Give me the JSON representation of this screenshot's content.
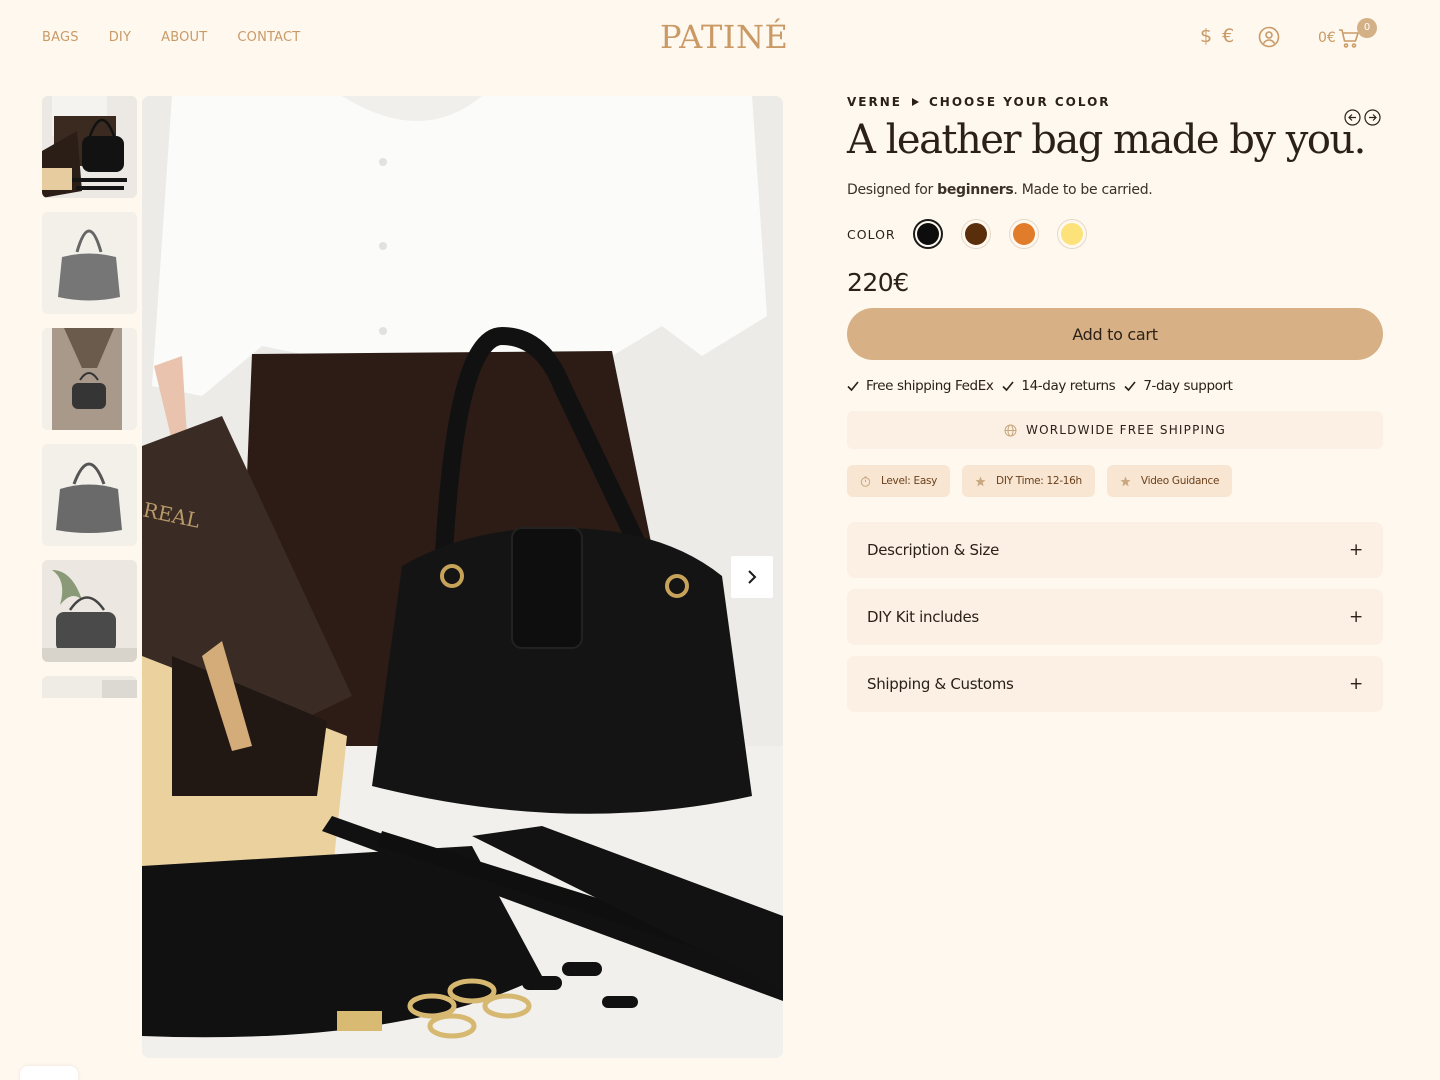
{
  "header": {
    "nav": [
      "BAGS",
      "DIY",
      "ABOUT",
      "CONTACT"
    ],
    "logo": "PATINÉ",
    "currency": "$ €",
    "cart_total": "0€",
    "cart_count": "0"
  },
  "gallery": {
    "thumbnails": [
      "kit-with-bag",
      "bag-front",
      "bag-held",
      "bag-front-2",
      "bag-plant",
      "partial"
    ],
    "next_icon": "chevron-right-icon"
  },
  "product": {
    "breadcrumb": [
      "VERNE",
      "CHOOSE YOUR COLOR"
    ],
    "title": "A leather bag made by you.",
    "subtitle_prefix": "Designed for ",
    "subtitle_bold": "beginners",
    "subtitle_suffix": ". Made to be carried.",
    "color_label": "COLOR",
    "colors": [
      "#0d0d0d",
      "#5a2e0b",
      "#e07c2a",
      "#fde27a"
    ],
    "selected_color": "#0d0d0d",
    "price": "220€",
    "add_to_cart": "Add to cart",
    "perks": [
      "Free shipping FedEx",
      "14-day returns",
      "7-day support"
    ],
    "shipping_banner": "WORLDWIDE FREE SHIPPING",
    "tags": [
      "Level: Easy",
      "DIY Time: 12-16h",
      "Video Guidance"
    ],
    "accordions": [
      "Description & Size",
      "DIY Kit includes",
      "Shipping & Customs"
    ],
    "accordion_icon": "+"
  }
}
